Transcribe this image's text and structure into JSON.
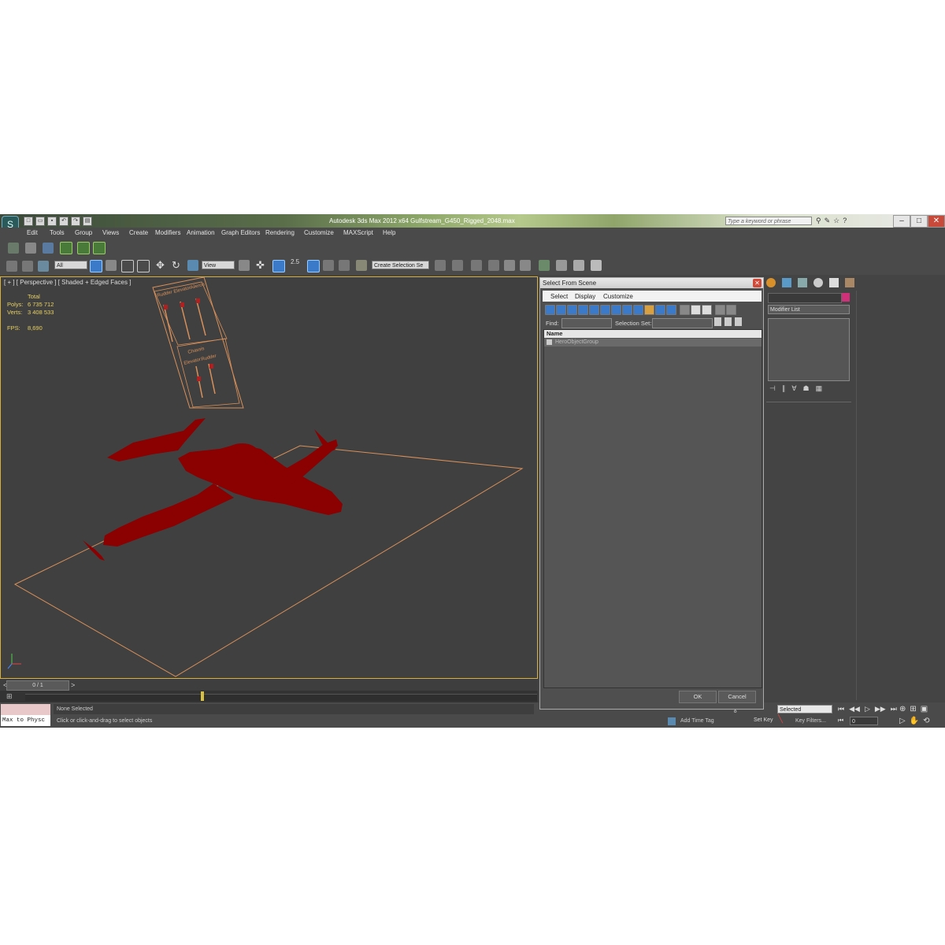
{
  "titlebar": {
    "title": "Autodesk 3ds Max  2012 x64     Gulfstream_G450_Rigged_2048.max",
    "search_placeholder": "Type a keyword or phrase"
  },
  "menu": [
    "Edit",
    "Tools",
    "Group",
    "Views",
    "Create",
    "Modifiers",
    "Animation",
    "Graph Editors",
    "Rendering",
    "Customize",
    "MAXScript",
    "Help"
  ],
  "toolbar": {
    "filter_value": "All",
    "refcoord_value": "View",
    "snap_value": "2.5",
    "selection_set_value": "Create Selection Se"
  },
  "viewport": {
    "label": "[ + ] [ Perspective ] [ Shaded + Edged Faces ]",
    "stats_header": "Total",
    "polys_label": "Polys:",
    "polys_value": "6 735 712",
    "verts_label": "Verts:",
    "verts_value": "3 408 533",
    "fps_label": "FPS:",
    "fps_value": "8,690",
    "panel_labels": [
      "Rudder",
      "Elevator",
      "Aileron",
      "Chassis",
      "Elevator",
      "Rudder"
    ]
  },
  "timeslider": {
    "frame_text": "0 / 1"
  },
  "status": {
    "maxscript_text": "Max to Physc",
    "selected_text": "None Selected",
    "prompt_text": "Click or click-and-drag to select objects",
    "add_time_tag": "Add Time Tag",
    "auto_key_value": "Selected",
    "set_key": "Set Key",
    "key_filters": "Key Filters...",
    "frame_value": "0"
  },
  "command_panel": {
    "modifier_list": "Modifier List"
  },
  "dialog": {
    "title": "Select From Scene",
    "menu": [
      "Select",
      "Display",
      "Customize"
    ],
    "find_label": "Find:",
    "selection_set_label": "Selection Set:",
    "column_name": "Name",
    "rows": [
      "HeroObjectGroup"
    ],
    "ok": "OK",
    "cancel": "Cancel"
  },
  "colors": {
    "viewport_bg": "#404040",
    "aircraft": "#8b0000",
    "grid_outline": "#d8905a",
    "stats_text": "#e8d060",
    "active_border": "#d8b040"
  }
}
